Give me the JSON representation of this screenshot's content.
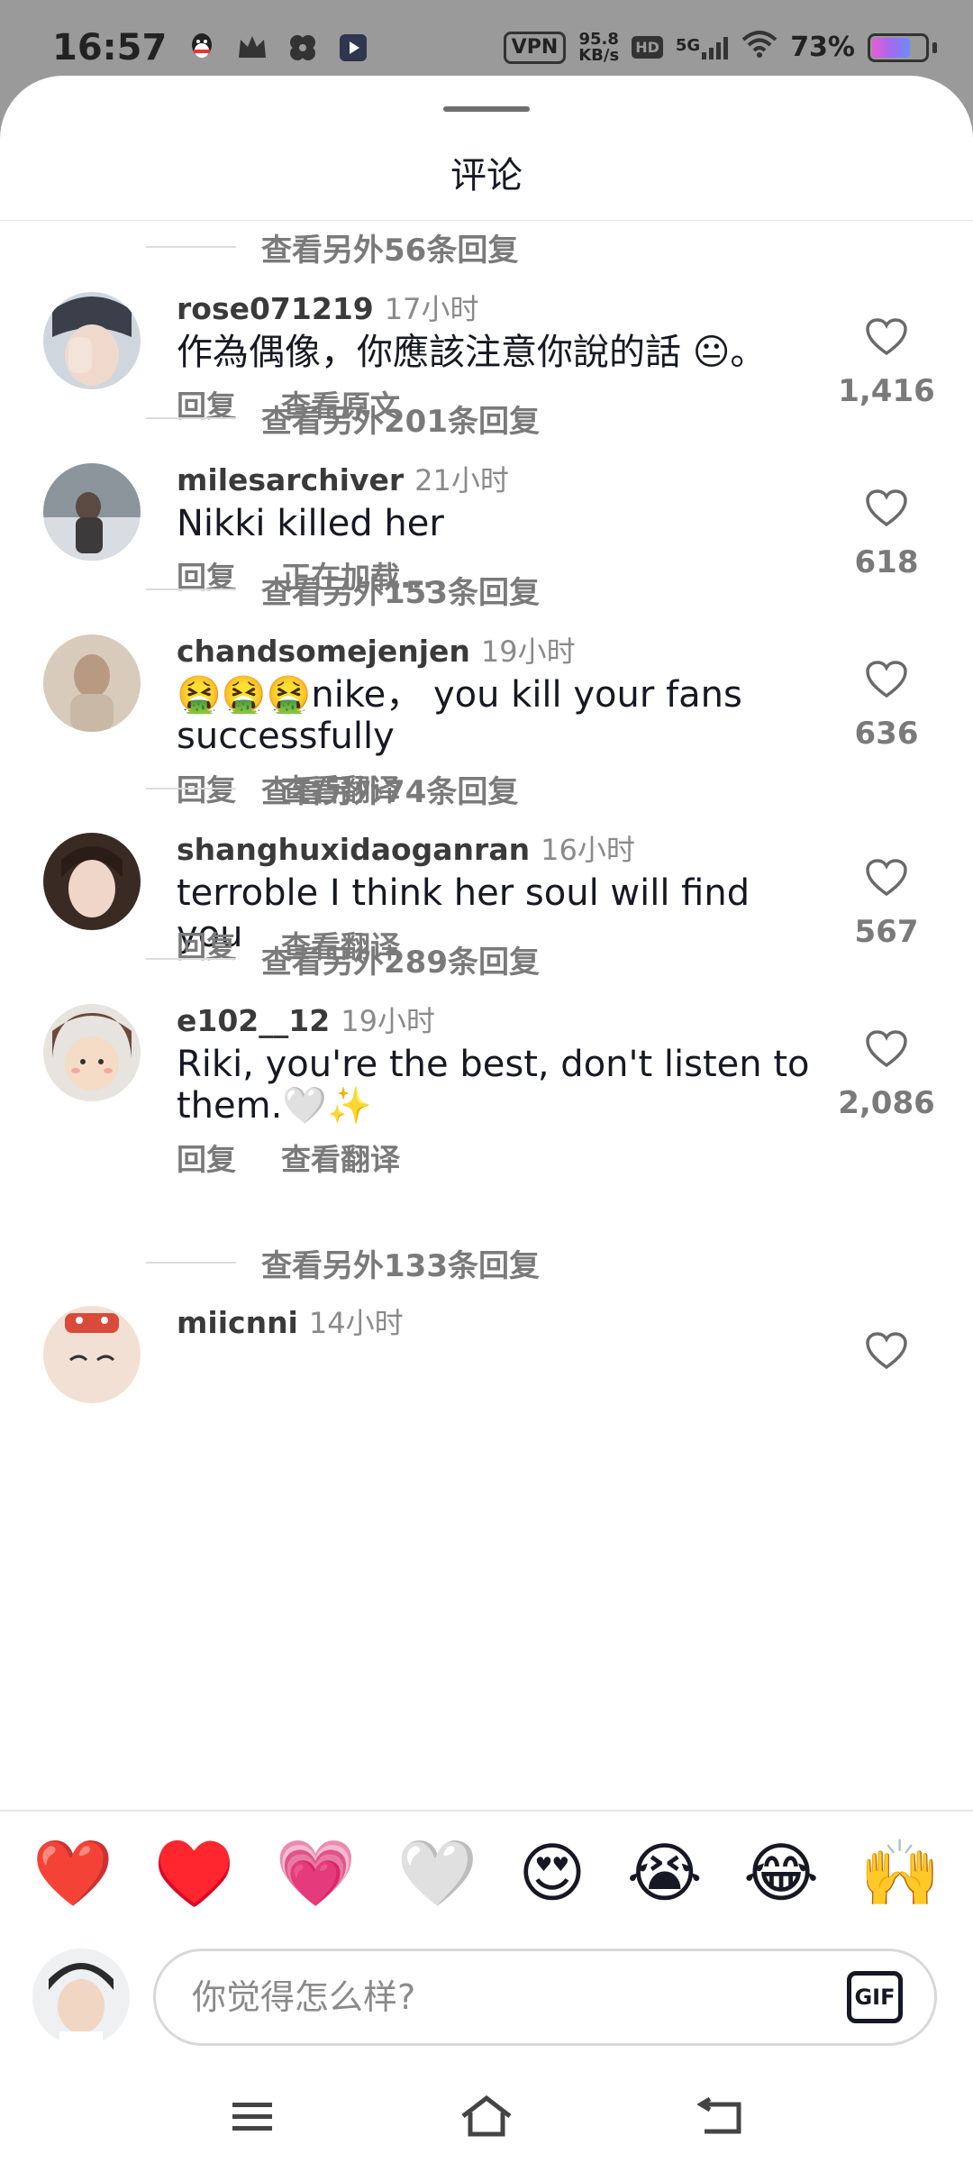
{
  "status_bar": {
    "time": "16:57",
    "vpn": "VPN",
    "net_speed_value": "95.8",
    "net_speed_unit": "KB/s",
    "hd": "HD",
    "network": "5G",
    "battery": "73%",
    "battery_level": 0.73
  },
  "sheet": {
    "title": "评论"
  },
  "reply_rows": [
    {
      "label": "查看另外56条回复"
    },
    {
      "label": "查看另外201条回复"
    },
    {
      "label": "查看另外153条回复"
    },
    {
      "label": "查看另外74条回复"
    },
    {
      "label": "查看另外289条回复"
    },
    {
      "label": "查看另外133条回复"
    }
  ],
  "comments": [
    {
      "user": "rose071219",
      "time": "17小时",
      "text": "作為偶像，你應該注意你說的話 😐。",
      "action_reply": "回复",
      "action_2": "查看原文",
      "likes": "1,416"
    },
    {
      "user": "milesarchiver",
      "time": "21小时",
      "text": "Nikki killed her",
      "action_reply": "回复",
      "action_2": "正在加载...",
      "likes": "618"
    },
    {
      "user": "chandsomejenjen",
      "time": "19小时",
      "text": "🤮🤮🤮nike， you kill your fans successfully",
      "action_reply": "回复",
      "action_2": "查看翻译",
      "likes": "636"
    },
    {
      "user": "shanghuxidaoganran",
      "time": "16小时",
      "text": "terroble I think her soul will find you",
      "action_reply": "回复",
      "action_2": "查看翻译",
      "likes": "567"
    },
    {
      "user": "e102__12",
      "time": "19小时",
      "text": "Riki, you're the best, don't listen to them.🤍✨",
      "action_reply": "回复",
      "action_2": "查看翻译",
      "likes": "2,086"
    },
    {
      "user": "miicnni",
      "time": "14小时",
      "text": "",
      "action_reply": "",
      "action_2": "",
      "likes": ""
    }
  ],
  "emoji_bar": [
    "❤️",
    "♥️",
    "💗",
    "🤍",
    "😍",
    "😭",
    "😂",
    "🙌"
  ],
  "composer": {
    "placeholder": "你觉得怎么样?",
    "gif_label": "GIF"
  },
  "colors": {
    "muted": "#7a7a7a",
    "primary_text": "#161823",
    "status_bg": "#9a9a9a"
  },
  "icons": {
    "status_apps": [
      "qq-icon",
      "crown-icon",
      "clover-icon",
      "video-app-icon"
    ],
    "like": "heart-outline-icon",
    "nav": [
      "menu-icon",
      "home-icon",
      "back-icon"
    ]
  }
}
